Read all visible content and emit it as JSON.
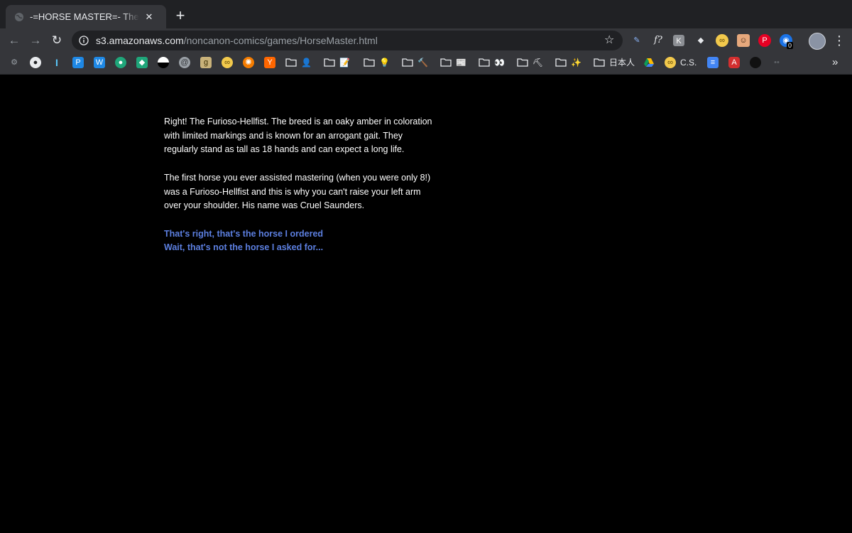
{
  "browser": {
    "tab": {
      "title": "-=HORSE MASTER=- The Game"
    },
    "url": {
      "host": "s3.amazonaws.com",
      "path": "/noncanon-comics/games/HorseMaster.html"
    },
    "extensions": [
      {
        "name": "eyedropper-extension",
        "color": "#35363a",
        "glyph": "✎"
      },
      {
        "name": "formula-extension",
        "color": "#35363a",
        "glyph": "f?"
      },
      {
        "name": "keyboard-extension",
        "color": "#8c8f94",
        "glyph": "K"
      },
      {
        "name": "vscode-extension",
        "color": "#35363a",
        "glyph": "◆"
      },
      {
        "name": "emoji-extension",
        "color": "#f2c94c",
        "glyph": "∞"
      },
      {
        "name": "character-extension",
        "color": "#e6a87c",
        "glyph": "☺"
      },
      {
        "name": "pinterest-extension",
        "color": "#e60023",
        "glyph": "P"
      },
      {
        "name": "notification-extension",
        "color": "#1a73e8",
        "glyph": "◉",
        "badge": "0"
      }
    ],
    "bookmarks_bar": {
      "japanese_label": "日本人",
      "cs_label": "C.S.",
      "overflow": "»"
    }
  },
  "page": {
    "paragraphs": [
      "Right! The Furioso-Hellfist. The breed is an oaky amber in coloration with limited markings and is known for an arrogant gait. They regularly stand as tall as 18 hands and can expect a long life.",
      "The first horse you ever assisted mastering (when you were only 8!) was a Furioso-Hellfist and this is why you can't raise your left arm over your shoulder. His name was Cruel Saunders."
    ],
    "choices": [
      "That's right, that's the horse I ordered",
      "Wait, that's not the horse I asked for..."
    ]
  }
}
